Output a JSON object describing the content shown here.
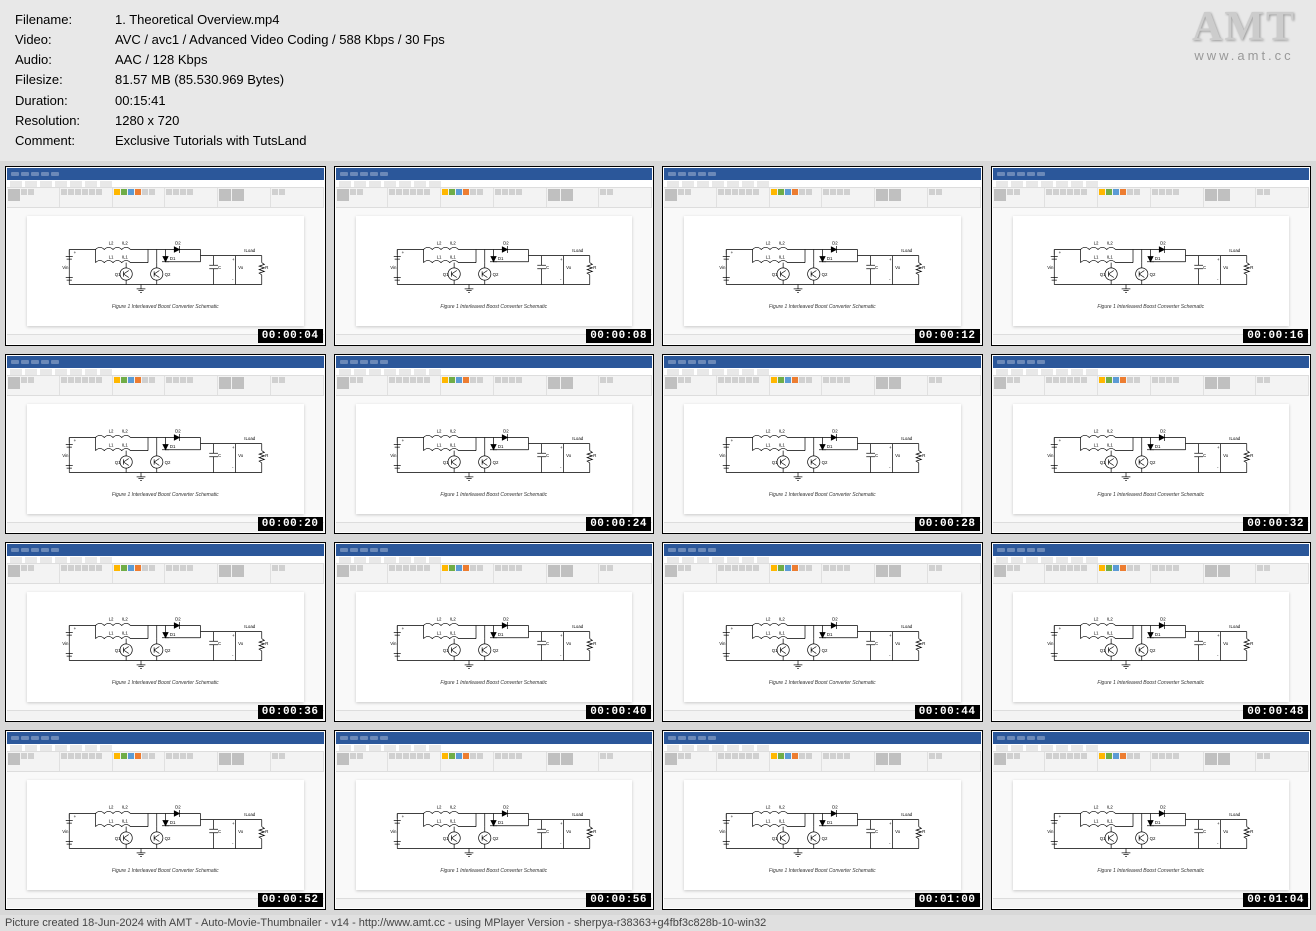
{
  "meta": {
    "filename_label": "Filename:",
    "filename": "1. Theoretical Overview.mp4",
    "video_label": "Video:",
    "video": "AVC / avc1 / Advanced Video Coding / 588 Kbps / 30 Fps",
    "audio_label": "Audio:",
    "audio": "AAC / 128 Kbps",
    "filesize_label": "Filesize:",
    "filesize": "81.57 MB (85.530.969 Bytes)",
    "duration_label": "Duration:",
    "duration": "00:15:41",
    "resolution_label": "Resolution:",
    "resolution": "1280 x 720",
    "comment_label": "Comment:",
    "comment": "Exclusive Tutorials with TutsLand"
  },
  "logo": {
    "main": "AMT",
    "sub": "www.amt.cc"
  },
  "circuit_caption": "Figure 1 Interleaved Boost Converter Schematic",
  "circuit_labels": {
    "vin": "Vin",
    "l1": "L1",
    "l2": "L2",
    "il1": "IL1",
    "il2": "IL2",
    "d1": "D1",
    "d2": "D2",
    "q1": "Q1",
    "q2": "Q2",
    "c": "C",
    "vo": "Vo",
    "r": "R",
    "iload": "ILoad"
  },
  "thumbnails": [
    {
      "ts": "00:00:04"
    },
    {
      "ts": "00:00:08"
    },
    {
      "ts": "00:00:12"
    },
    {
      "ts": "00:00:16"
    },
    {
      "ts": "00:00:20"
    },
    {
      "ts": "00:00:24"
    },
    {
      "ts": "00:00:28"
    },
    {
      "ts": "00:00:32"
    },
    {
      "ts": "00:00:36"
    },
    {
      "ts": "00:00:40"
    },
    {
      "ts": "00:00:44"
    },
    {
      "ts": "00:00:48"
    },
    {
      "ts": "00:00:52"
    },
    {
      "ts": "00:00:56"
    },
    {
      "ts": "00:01:00"
    },
    {
      "ts": "00:01:04"
    }
  ],
  "footer": "Picture created 18-Jun-2024 with AMT - Auto-Movie-Thumbnailer - v14 - http://www.amt.cc - using MPlayer Version - sherpya-r38363+g4fbf3c828b-10-win32"
}
